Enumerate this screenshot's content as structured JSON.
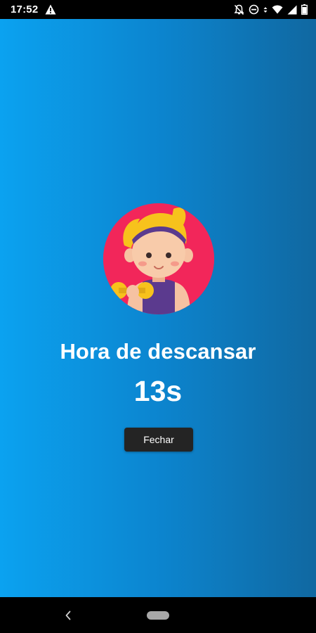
{
  "status_bar": {
    "time": "17:52",
    "icons": [
      "warning-icon",
      "notifications-off-icon",
      "do-not-disturb-icon",
      "data-arrows-icon",
      "wifi-icon",
      "cell-signal-icon",
      "battery-icon"
    ]
  },
  "rest": {
    "avatar_icon": "woman-with-dumbbell-avatar",
    "title": "Hora de descansar",
    "timer": "13s",
    "close_label": "Fechar"
  },
  "nav_bar": {
    "icons": [
      "back-icon",
      "home-pill"
    ]
  },
  "colors": {
    "gradient_start": "#0ba2f0",
    "gradient_end": "#1068a1",
    "avatar_background": "#f2265a",
    "button_background": "#242424",
    "text": "#ffffff"
  }
}
